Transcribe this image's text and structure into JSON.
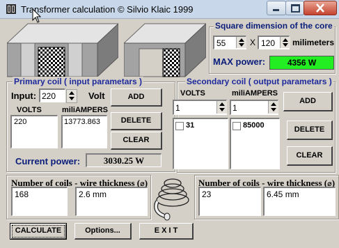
{
  "window": {
    "title": "Transformer calculation © Silvio Klaic 1999"
  },
  "core": {
    "group_label": "Square dimension of the core",
    "width_value": "55",
    "x_label": "X",
    "height_value": "120",
    "unit_label": "milimeters",
    "max_power_label": "MAX power:",
    "max_power_value": "4356 W"
  },
  "primary": {
    "group_label": "Primary coil ( input parametars )",
    "input_label": "Input:",
    "input_value": "220",
    "volt_label": "Volt",
    "volts_header": "VOLTS",
    "milliamps_header": "miliAMPERS",
    "volts_items": [
      "220"
    ],
    "milliamps_items": [
      "13773.863"
    ],
    "add_label": "ADD",
    "delete_label": "DELETE",
    "clear_label": "CLEAR",
    "current_power_label": "Current power:",
    "current_power_value": "3030.25 W"
  },
  "secondary": {
    "group_label": "Secondary coil ( output parametars )",
    "volts_header": "VOLTS",
    "milliamps_header": "miliAMPERS",
    "volts_value": "1",
    "milliamps_value": "1",
    "volts_items": [
      "31"
    ],
    "milliamps_items": [
      "85000"
    ],
    "add_label": "ADD",
    "delete_label": "DELETE",
    "clear_label": "CLEAR"
  },
  "primary_result": {
    "label": "Number of coils - wire thickness (",
    "diameter_symbol": "⌀",
    "label_end": ")",
    "coils": "168",
    "thickness": "2.6 mm"
  },
  "secondary_result": {
    "label": "Number of coils - wire thickness (",
    "diameter_symbol": "⌀",
    "label_end": ")",
    "coils": "23",
    "thickness": "6.45 mm"
  },
  "actions": {
    "calculate_label": "CALCULATE",
    "options_label": "Options...",
    "exit_label": "E X I T"
  },
  "colors": {
    "title_bar": "#c8d8ea",
    "max_power_bg": "#22ee22",
    "group_label_color": "#1e2a9c",
    "close_button": "#c4432f"
  }
}
